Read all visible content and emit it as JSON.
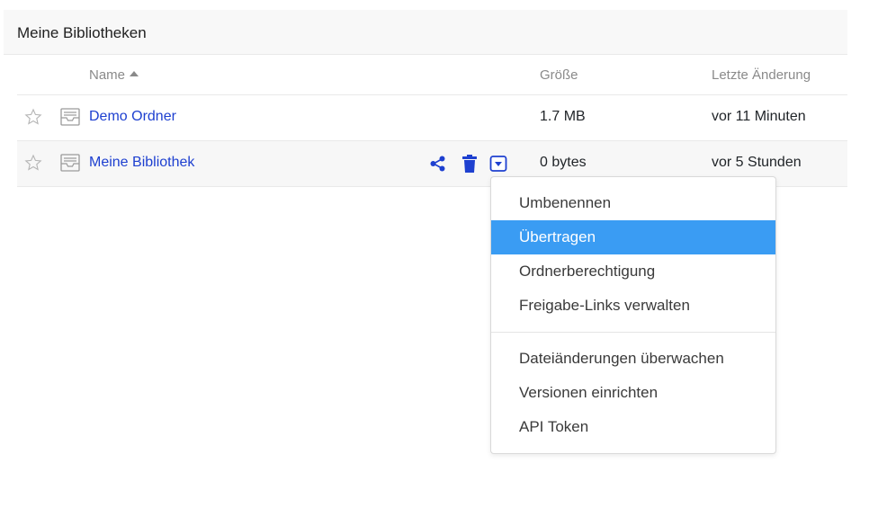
{
  "panel": {
    "title": "Meine Bibliotheken"
  },
  "table": {
    "columns": {
      "name": "Name",
      "size": "Größe",
      "modified": "Letzte Änderung"
    },
    "sort": "name-ascending",
    "rows": [
      {
        "name": "Demo Ordner",
        "size": "1.7 MB",
        "modified": "vor 11 Minuten",
        "starred": false
      },
      {
        "name": "Meine Bibliothek",
        "size": "0 bytes",
        "modified": "vor 5 Stunden",
        "starred": false
      }
    ]
  },
  "row_actions": {
    "icons": [
      "share-icon",
      "trash-icon",
      "dropdown-toggle-icon"
    ]
  },
  "context_menu": {
    "items": [
      "Umbenennen",
      "Übertragen",
      "Ordnerberechtigung",
      "Freigabe-Links verwalten",
      "Dateiänderungen überwachen",
      "Versionen einrichten",
      "API Token"
    ],
    "highlighted_item": "Übertragen"
  },
  "colors": {
    "link": "#1e40d0",
    "menu_highlight": "#3a9cf3",
    "header_bg": "#f8f8f8"
  }
}
